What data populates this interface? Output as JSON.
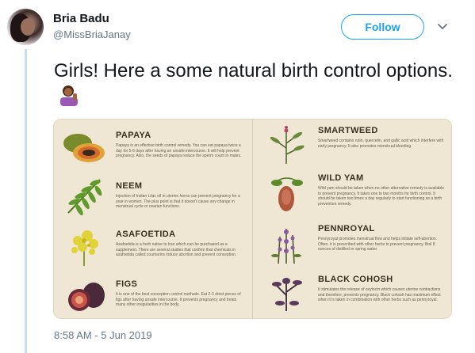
{
  "tweet": {
    "author_name": "Bria Badu",
    "author_handle": "@MissBriaJanay",
    "follow_label": "Follow",
    "text": "Girls! Here a some natural birth control options.",
    "timestamp": "8:58 AM - 5 Jun 2019"
  },
  "card": {
    "left": [
      {
        "title": "PAPAYA",
        "description": "Papaya is an effective birth control remedy. You can eat papaya twice a day for 5-6 days after having an unsafe intercourse. It will help prevent pregnancy. Also, the seeds of papaya reduce the sperm count in males."
      },
      {
        "title": "NEEM",
        "description": "Injection of Indian Lilac oil in uterine horns can prevent pregnancy for a year in women. The plus point is that it doesn't cause any change in menstrual cycle or ovarian functions."
      },
      {
        "title": "ASAFOETIDA",
        "description": "Asafoetida is a herb native to Iran which can be purchased as a supplement. There are several studies that confirm that chemicals in asafoetida called coumarins induce abortion and prevent conception."
      },
      {
        "title": "FIGS",
        "description": "It is one of the best conception control methods. Eat 2-3 dried pieces of figs after having unsafe intercourse. It prevents pregnancy and treats many other irregularities in the body."
      }
    ],
    "right": [
      {
        "title": "SMARTWEED",
        "description": "Smartweed contains rutin, quercetin, and gallic acid which interfere with early pregnancy. It also promotes menstrual bleeding."
      },
      {
        "title": "WILD YAM",
        "description": "Wild yam should be taken when no other alternative remedy is available to prevent pregnancy. It takes one to two months for birth control. It should be taken two times a day regularly to start functioning as a birth prevention remedy."
      },
      {
        "title": "PENNROYAL",
        "description": "Pennyroyal promotes menstrual flow and helps initiate self-abortion. Often, it is prescribed with other herbs to prevent pregnancy. Boil 8 ounces of distilled or spring water."
      },
      {
        "title": "BLACK COHOSH",
        "description": "It stimulates the release of oxytocin which causes uterine contractions and therefore, prevents pregnancy. Black cohosh has maximum effect when it is taken in combination with other herbs such as pennyroyal."
      }
    ]
  },
  "colors": {
    "accent": "#1da1f2",
    "secondary_text": "#657786",
    "card_background": "#efe6d3",
    "thread_line": "#c4e0f0"
  },
  "icons": {
    "emoji": "woman-tipping-hand-emoji",
    "caret": "chevron-down-icon"
  }
}
